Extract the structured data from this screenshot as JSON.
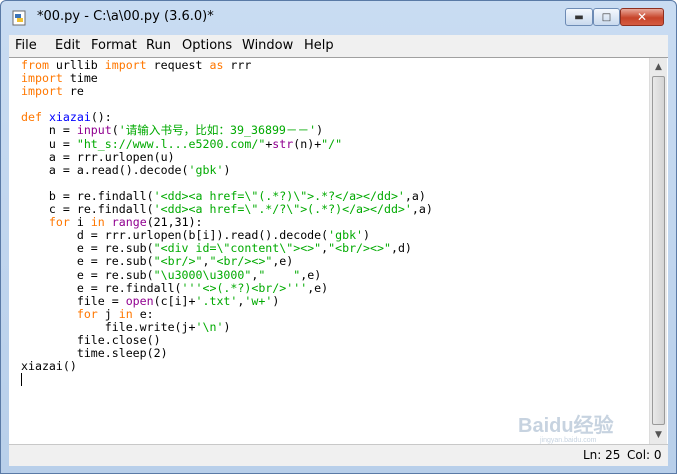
{
  "window": {
    "title": "*00.py - C:\\a\\00.py (3.6.0)*",
    "buttons": {
      "minimize": "▬",
      "maximize": "□",
      "close": "✕"
    }
  },
  "menubar": {
    "items": [
      "File",
      "Edit",
      "Format",
      "Run",
      "Options",
      "Window",
      "Help"
    ]
  },
  "editor": {
    "lines": [
      "from urllib import request as rrr",
      "import time",
      "import re",
      "",
      "def xiazai():",
      "    n = input('请输入书号，比如：39_36899－－')",
      "    u = \"ht_s://www.l...e5200.com/\"+str(n)+\"/\"",
      "    a = rrr.urlopen(u)",
      "    a = a.read().decode('gbk')",
      "",
      "    b = re.findall('<dd><a href=\\\"(.*?)\\\">.*?</a></dd>',a)",
      "    c = re.findall('<dd><a href=\\\".*/?\\\">(.*?)</a></dd>',a)",
      "    for i in range(21,31):",
      "        d = rrr.urlopen(b[i]).read().decode('gbk')",
      "        e = re.sub(\"<div id=\\\"content\\\"><>\",\"<br/><>\",d)",
      "        e = re.sub(\"<br/>\",\"<br/><>\",e)",
      "        e = re.sub(\"\\u3000\\u3000\",\"    \",e)",
      "        e = re.findall('''<>(.*?)<br/>''',e)",
      "        file = open(c[i]+'.txt','w+')",
      "        for j in e:",
      "            file.write(j+'\\n')",
      "        file.close()",
      "        time.sleep(2)",
      "xiazai()"
    ]
  },
  "status": {
    "line": "Ln: 25",
    "col": "Col: 0"
  },
  "watermark": {
    "text": "Baidu经验",
    "sub": "jingyan.baidu.com"
  },
  "colors": {
    "keyword": "#ff7700",
    "builtin": "#900090",
    "string": "#00aa00",
    "definition": "#0000ff"
  }
}
